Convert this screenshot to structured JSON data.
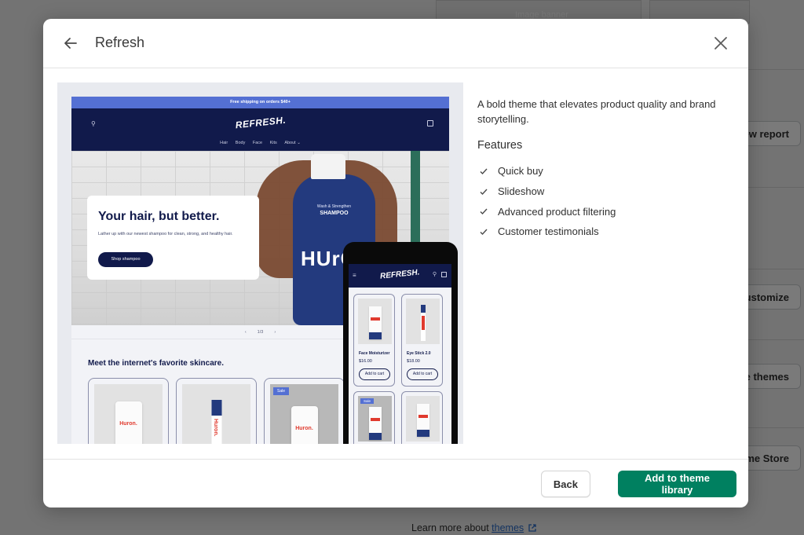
{
  "background": {
    "thumb_label": "Image banner",
    "buttons": [
      "View report",
      "Customize",
      "Explore free themes",
      "Visit Theme Store"
    ],
    "learn_more": {
      "prefix": "Learn more about ",
      "link": "themes"
    }
  },
  "modal": {
    "title": "Refresh",
    "back_icon": "arrow-left-icon",
    "close_icon": "close-icon",
    "description": "A bold theme that elevates product quality and brand storytelling.",
    "features_title": "Features",
    "features": [
      "Quick buy",
      "Slideshow",
      "Advanced product filtering",
      "Customer testimonials"
    ],
    "footer": {
      "back_label": "Back",
      "primary_label": "Add to theme library"
    }
  },
  "preview": {
    "announcement": "Free shipping on orders $40+",
    "logo": "REFRESH.",
    "nav": [
      "Hair",
      "Body",
      "Face",
      "Kits",
      "About ⌄"
    ],
    "hero": {
      "title": "Your hair, but better.",
      "description": "Lather up with our newest shampoo for clean, strong, and healthy hair.",
      "button": "Shop shampoo",
      "bottle_small": "Wash & Strengthen",
      "bottle_label": "SHAMPOO",
      "bottle_brand": "HUrO"
    },
    "slider": {
      "prev": "‹",
      "counter": "1/3",
      "next": "›"
    },
    "section_title": "Meet the internet's favorite skincare.",
    "brand": "Huron.",
    "sale_badge": "Sale",
    "mobile_products": [
      {
        "name": "Face Moisturizer",
        "price": "$16.00",
        "button": "Add to cart"
      },
      {
        "name": "Eye Stick 2.0",
        "price": "$18.00",
        "button": "Add to cart"
      }
    ]
  },
  "colors": {
    "primary_button": "#008060",
    "preview_navy": "#111a4b",
    "preview_announce": "#5470d3"
  }
}
